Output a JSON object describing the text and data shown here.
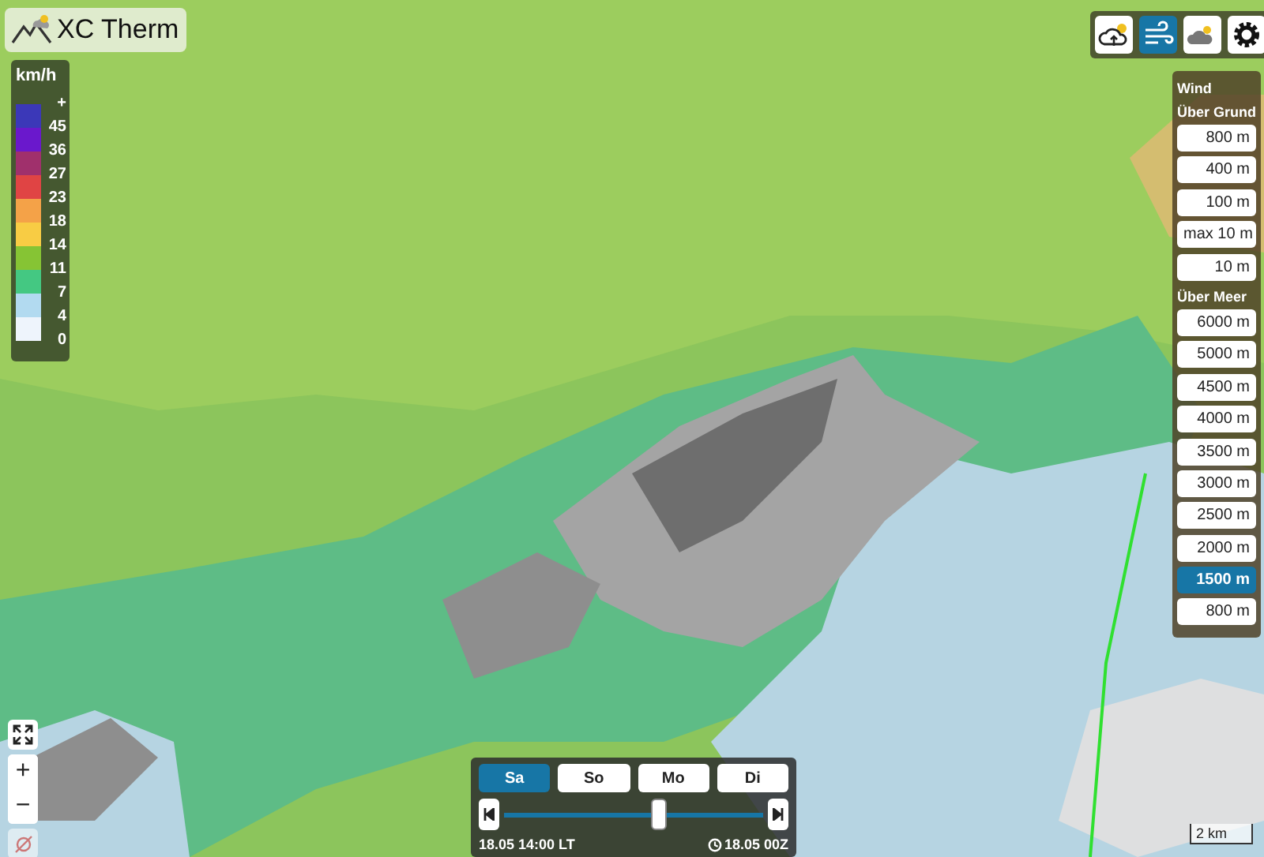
{
  "app": {
    "title": "XC Therm"
  },
  "legend": {
    "unit": "km/h",
    "ticks": [
      "+",
      "45",
      "36",
      "27",
      "23",
      "18",
      "14",
      "11",
      "7",
      "4",
      "0"
    ],
    "swatches": [
      {
        "color": "#3b38b8"
      },
      {
        "color": "#6a18cc"
      },
      {
        "color": "#a0306c"
      },
      {
        "color": "#e04444"
      },
      {
        "color": "#f4a248"
      },
      {
        "color": "#f8cc44"
      },
      {
        "color": "#86c434"
      },
      {
        "color": "#44c882"
      },
      {
        "color": "#b2daf0"
      },
      {
        "color": "#eef4fc"
      }
    ]
  },
  "layer_buttons": [
    {
      "kind": "thermal",
      "selected": false
    },
    {
      "kind": "wind",
      "selected": true
    },
    {
      "kind": "clouds",
      "selected": false
    },
    {
      "kind": "settings",
      "selected": false
    }
  ],
  "wind_panel": {
    "title": "Wind",
    "sections": [
      {
        "heading": "Über Grund",
        "levels": [
          {
            "label": "800 m",
            "selected": false
          },
          {
            "label": "400 m",
            "selected": false
          },
          {
            "label": "100 m",
            "selected": false
          },
          {
            "label": "max 10 m",
            "selected": false
          },
          {
            "label": "10 m",
            "selected": false
          }
        ]
      },
      {
        "heading": "Über Meer",
        "levels": [
          {
            "label": "6000 m",
            "selected": false
          },
          {
            "label": "5000 m",
            "selected": false
          },
          {
            "label": "4500 m",
            "selected": false
          },
          {
            "label": "4000 m",
            "selected": false
          },
          {
            "label": "3500 m",
            "selected": false
          },
          {
            "label": "3000 m",
            "selected": false
          },
          {
            "label": "2500 m",
            "selected": false
          },
          {
            "label": "2000 m",
            "selected": false
          },
          {
            "label": "1500 m",
            "selected": true
          },
          {
            "label": "800 m",
            "selected": false
          }
        ]
      }
    ]
  },
  "time_panel": {
    "days": [
      {
        "label": "Sa",
        "selected": true
      },
      {
        "label": "So",
        "selected": false
      },
      {
        "label": "Mo",
        "selected": false
      },
      {
        "label": "Di",
        "selected": false
      }
    ],
    "slider": {
      "level": 0.6
    },
    "local_time": "18.05 14:00 LT",
    "model_run": "18.05 00Z"
  },
  "map_controls": {
    "zoom_in": "+",
    "zoom_out": "−"
  },
  "scale": "2 km"
}
